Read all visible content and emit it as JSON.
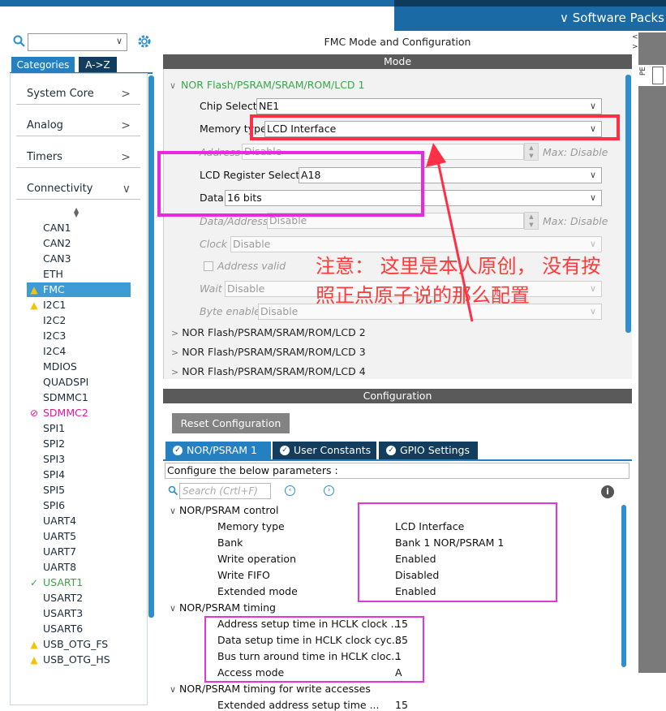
{
  "top": {
    "software_packs": "∨ Software Packs"
  },
  "left": {
    "tabs": [
      "Categories",
      "A->Z"
    ],
    "categories": [
      {
        "label": "System Core",
        "chev": ">"
      },
      {
        "label": "Analog",
        "chev": ">"
      },
      {
        "label": "Timers",
        "chev": ">"
      },
      {
        "label": "Connectivity",
        "chev": "∨"
      }
    ],
    "items": [
      {
        "label": "CAN1",
        "status": ""
      },
      {
        "label": "CAN2",
        "status": ""
      },
      {
        "label": "CAN3",
        "status": ""
      },
      {
        "label": "ETH",
        "status": ""
      },
      {
        "label": "FMC",
        "status": "warning"
      },
      {
        "label": "I2C1",
        "status": "warning"
      },
      {
        "label": "I2C2",
        "status": ""
      },
      {
        "label": "I2C3",
        "status": ""
      },
      {
        "label": "I2C4",
        "status": ""
      },
      {
        "label": "MDIOS",
        "status": ""
      },
      {
        "label": "QUADSPI",
        "status": ""
      },
      {
        "label": "SDMMC1",
        "status": ""
      },
      {
        "label": "SDMMC2",
        "status": "blocked"
      },
      {
        "label": "SPI1",
        "status": ""
      },
      {
        "label": "SPI2",
        "status": ""
      },
      {
        "label": "SPI3",
        "status": ""
      },
      {
        "label": "SPI4",
        "status": ""
      },
      {
        "label": "SPI5",
        "status": ""
      },
      {
        "label": "SPI6",
        "status": ""
      },
      {
        "label": "UART4",
        "status": ""
      },
      {
        "label": "UART5",
        "status": ""
      },
      {
        "label": "UART7",
        "status": ""
      },
      {
        "label": "UART8",
        "status": ""
      },
      {
        "label": "USART1",
        "status": "ok"
      },
      {
        "label": "USART2",
        "status": ""
      },
      {
        "label": "USART3",
        "status": ""
      },
      {
        "label": "USART6",
        "status": ""
      },
      {
        "label": "USB_OTG_FS",
        "status": "warning"
      },
      {
        "label": "USB_OTG_HS",
        "status": "warning"
      }
    ],
    "colors": {
      "selected": "#3d9bd6",
      "warning": "#f5c400",
      "blocked": "#e0189a",
      "ok": "#3aa64a"
    }
  },
  "mode": {
    "title": "FMC Mode and Configuration",
    "header": "Mode",
    "tree_open": "NOR Flash/PSRAM/SRAM/ROM/LCD 1",
    "tree_closed": [
      "NOR Flash/PSRAM/SRAM/ROM/LCD 2",
      "NOR Flash/PSRAM/SRAM/ROM/LCD 3",
      "NOR Flash/PSRAM/SRAM/ROM/LCD 4"
    ],
    "fields": {
      "chip_select": {
        "label": "Chip Select",
        "value": "NE1"
      },
      "memory_type": {
        "label": "Memory type",
        "value": "LCD Interface"
      },
      "address": {
        "label": "Address",
        "value": "Disable",
        "max": "Max: Disable"
      },
      "lcd_register_select": {
        "label": "LCD Register Select",
        "value": "A18"
      },
      "data": {
        "label": "Data",
        "value": "16 bits"
      },
      "data_address": {
        "label": "Data/Address",
        "value": "Disable",
        "max": "Max: Disable"
      },
      "clock": {
        "label": "Clock",
        "value": "Disable"
      },
      "address_valid": {
        "label": "Address valid"
      },
      "wait": {
        "label": "Wait",
        "value": "Disable"
      },
      "byte_enable": {
        "label": "Byte enable",
        "value": "Disable"
      }
    }
  },
  "config": {
    "header": "Configuration",
    "reset_button": "Reset Configuration",
    "tabs": [
      "NOR/PSRAM 1",
      "User Constants",
      "GPIO Settings"
    ],
    "description": "Configure the below parameters :",
    "search_placeholder": "Search (Crtl+F)",
    "groups": [
      {
        "name": "NOR/PSRAM control",
        "rows": [
          {
            "label": "Memory type",
            "value": "LCD Interface"
          },
          {
            "label": "Bank",
            "value": "Bank 1 NOR/PSRAM 1"
          },
          {
            "label": "Write operation",
            "value": "Enabled"
          },
          {
            "label": "Write FIFO",
            "value": "Disabled"
          },
          {
            "label": "Extended mode",
            "value": "Enabled"
          }
        ]
      },
      {
        "name": "NOR/PSRAM timing",
        "rows": [
          {
            "label": "Address setup time in HCLK clock ...",
            "value": "15"
          },
          {
            "label": "Data setup time in HCLK clock cyc...",
            "value": "85"
          },
          {
            "label": "Bus turn around time in HCLK cloc...",
            "value": "1"
          },
          {
            "label": "Access mode",
            "value": "A"
          }
        ]
      },
      {
        "name": "NOR/PSRAM timing for write accesses",
        "rows": [
          {
            "label": "Extended address setup time ...",
            "value": "15"
          }
        ]
      }
    ]
  },
  "annotation": {
    "text_line1": "注意： 这里是本人原创， 没有按",
    "text_line2": "照正点原子说的那么配置",
    "colors": {
      "red": "#ff2f46",
      "magenta": "#ea28e4"
    }
  },
  "right": {
    "tab_label": "PE"
  }
}
